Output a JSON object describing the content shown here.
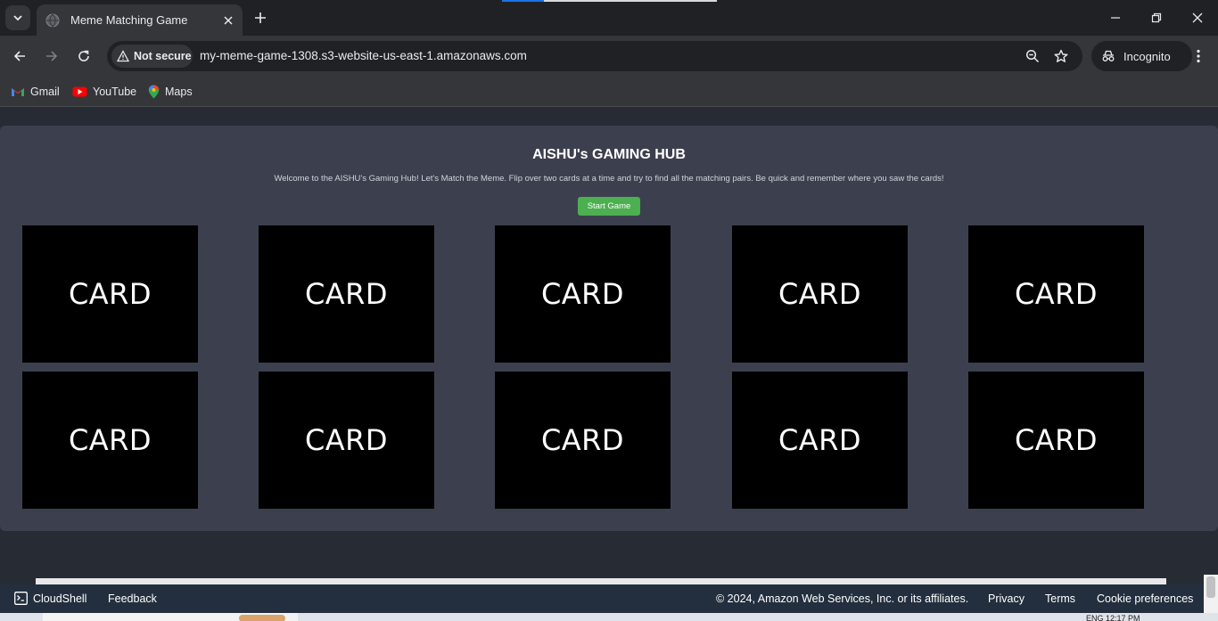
{
  "browser": {
    "active_tab_title": "Meme Matching Game",
    "security_label": "Not secure",
    "url": "my-meme-game-1308.s3-website-us-east-1.amazonaws.com",
    "profile_label": "Incognito",
    "bookmarks": [
      {
        "label": "Gmail",
        "icon": "gmail-icon"
      },
      {
        "label": "YouTube",
        "icon": "youtube-icon"
      },
      {
        "label": "Maps",
        "icon": "maps-icon"
      }
    ]
  },
  "page": {
    "title": "AISHU's GAMING HUB",
    "subtitle": "Welcome to the AISHU's Gaming Hub! Let's Match the Meme. Flip over two cards at a time and try to find all the matching pairs. Be quick and remember where you saw the cards!",
    "start_button": "Start Game",
    "cards": [
      "CARD",
      "CARD",
      "CARD",
      "CARD",
      "CARD",
      "CARD",
      "CARD",
      "CARD",
      "CARD",
      "CARD"
    ]
  },
  "footer": {
    "cloudshell": "CloudShell",
    "feedback": "Feedback",
    "copyright": "© 2024, Amazon Web Services, Inc. or its affiliates.",
    "privacy": "Privacy",
    "terms": "Terms",
    "cookies": "Cookie preferences"
  },
  "taskbar": {
    "tray_text": "ENG 12:17 PM"
  },
  "colors": {
    "start_button": "#4caf50",
    "panel": "#3c404e",
    "card": "#000000"
  }
}
